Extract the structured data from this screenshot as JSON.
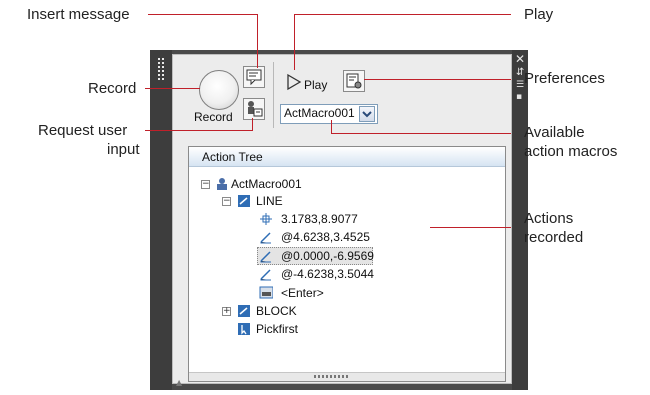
{
  "callouts": {
    "insert_message": "Insert message",
    "record": "Record",
    "request_user_input_line1": "Request user",
    "request_user_input_line2": "input",
    "play": "Play",
    "preferences": "Preferences",
    "available_macros_line1": "Available",
    "available_macros_line2": "action macros",
    "actions_recorded_line1": "Actions",
    "actions_recorded_line2": "recorded"
  },
  "panel": {
    "record_label": "Record",
    "play_label": "Play",
    "selected_macro": "ActMacro001"
  },
  "tree": {
    "header": "Action Tree",
    "root": "ActMacro001",
    "line_cmd": "LINE",
    "points": [
      "3.1783,8.9077",
      "@4.6238,3.4525",
      "@0.0000,-6.9569",
      "@-4.6238,3.5044"
    ],
    "enter": "<Enter>",
    "block_cmd": "BLOCK",
    "pickfirst": "Pickfirst"
  },
  "colors": {
    "callout_line": "#c0202a",
    "palette_dark": "#4a4a4a",
    "header_blue": "#d6e4f2"
  }
}
